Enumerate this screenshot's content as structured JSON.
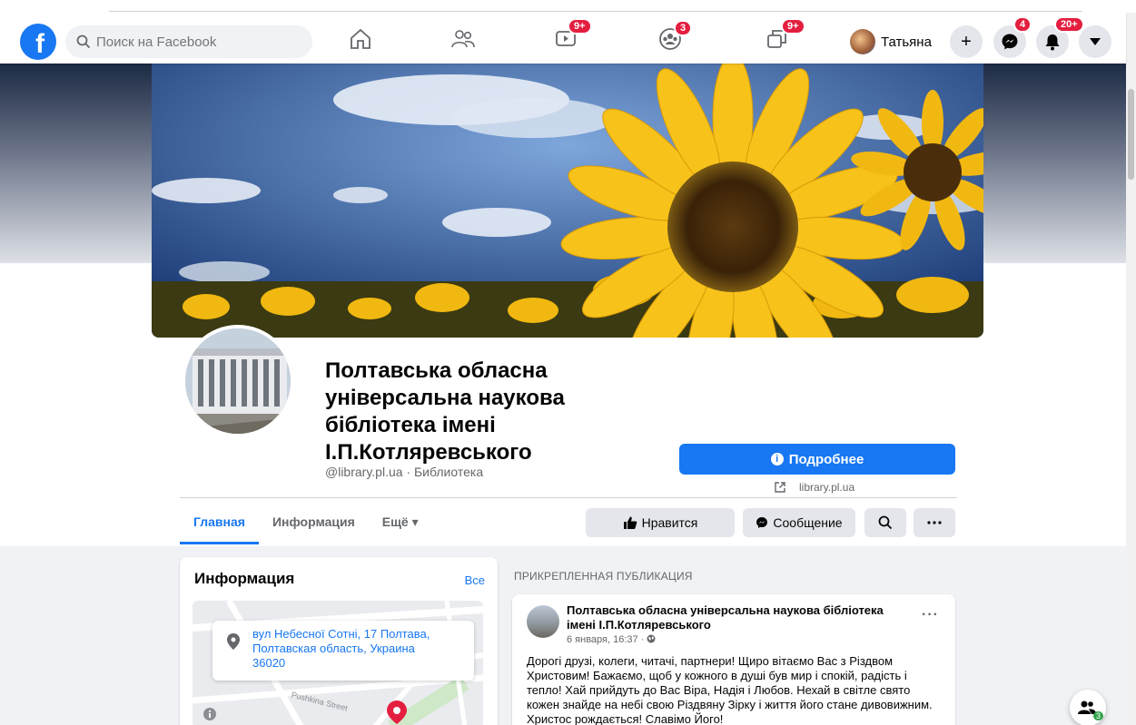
{
  "topbar": {
    "logo_letter": "f",
    "search_placeholder": "Поиск на Facebook",
    "badges": {
      "watch": "9+",
      "groups": "3",
      "gaming": "9+",
      "messenger": "4",
      "notifications": "20+"
    },
    "user_name": "Татьяна",
    "create_label": "+"
  },
  "page": {
    "name": "Полтавська обласна універсальна наукова бібліотека імені І.П.Котляревського",
    "subtitle": "@library.pl.ua · Библиотека",
    "details_button": "Подробнее",
    "website": "library.pl.ua"
  },
  "tabs": [
    {
      "label": "Главная",
      "active": true
    },
    {
      "label": "Информация",
      "active": false
    },
    {
      "label": "Ещё ▾",
      "active": false
    }
  ],
  "actions": {
    "like": "Нравится",
    "message": "Сообщение"
  },
  "info_card": {
    "title": "Информация",
    "see_all": "Все",
    "address": "вул Небесної Сотні, 17 Полтава, Полтавская область, Украина 36020",
    "map_labels": {
      "street": "Pushkina Street"
    }
  },
  "pinned": {
    "label": "ПРИКРЕПЛЕННАЯ ПУБЛИКАЦИЯ",
    "author": "Полтавська обласна універсальна наукова бібліотека імені І.П.Котляревського",
    "date": "6 января, 16:37 ·",
    "text": "Дорогі друзі, колеги, читачі, партнери! Щиро вітаємо Вас з Різдвом Христовим! Бажаємо, щоб у кожного в душі був мир і спокій, радість і тепло! Хай прийдуть до Вас Віра, Надія і Любов. Нехай в світле свято кожен знайде на небі свою Різдвяну Зірку і життя його стане дивовижним. Христос рождається! Славімо Його!"
  },
  "contacts_count": "3",
  "colors": {
    "brand": "#1877f2",
    "badge": "#e41e3f"
  }
}
